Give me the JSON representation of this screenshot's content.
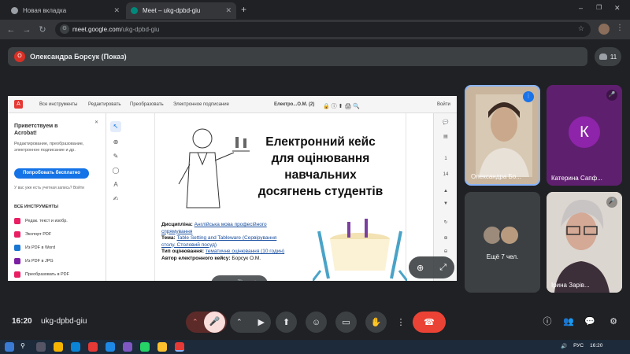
{
  "browser": {
    "tabs": [
      {
        "label": "Новая вкладка",
        "active": false
      },
      {
        "label": "Meet – ukg-dpbd-giu",
        "active": true
      }
    ],
    "url_host": "meet.google.com",
    "url_path": "/ukg-dpbd-giu"
  },
  "meet": {
    "presenter_initial": "О",
    "presenter_title": "Олександра Борсук (Показ)",
    "people_count": "11",
    "clock": "16:20",
    "meeting_code": "ukg-dpbd-giu"
  },
  "acrobat": {
    "tabs": [
      "Все инструменты",
      "Редактировать",
      "Преобразовать",
      "Электронное подписание"
    ],
    "doc_title": "Електро...О.М. (2)",
    "signin_btn": "Войти",
    "welcome": "Приветствуем в Acrobat!",
    "welcome_desc": "Редактирование, преобразование, электронное подписание и др.",
    "try_btn": "Попробовать бесплатно",
    "signin_prompt": "У вас уже есть учетная запись? Войти",
    "all_tools": "ВСЕ ИНСТРУМЕНТЫ",
    "tool_items": [
      "Редак. текст и изобр.",
      "Экспорт PDF",
      "Из PDF в Word",
      "Из PDF в JPG",
      "Преобразовать в PDF"
    ],
    "page_num": "1",
    "page_total": "14"
  },
  "slide": {
    "title_lines": [
      "Електронний кейс",
      "для оцінювання",
      "навчальних",
      "досягнень студентів"
    ],
    "info": [
      {
        "label": "Дисципліна:",
        "value": "Англійська мова професійного спрямування"
      },
      {
        "label": "Тема:",
        "value": "Table Setting and Tableware (Сервірування столу. Столовий посуд)"
      },
      {
        "label": "Тип оцінювання:",
        "value": "тематичне оцінювання (10 годин)"
      },
      {
        "label": "Автор електронного кейсу:",
        "value": "Борсук О.М."
      }
    ]
  },
  "participants": [
    {
      "name": "Олександра Бо...",
      "bg": "#c9b59d"
    },
    {
      "name": "Катерина Сапф...",
      "initial": "К",
      "bg": "#5f1f6f",
      "avatar_bg": "#8e24aa"
    },
    {
      "name": "Ещё 7 чел.",
      "bg": "#3c4043"
    },
    {
      "name": "Ірина Зарів...",
      "bg": "#d9d3cf"
    }
  ],
  "colors": {
    "end_call": "#ea4335",
    "mic_off": "#f9dedc",
    "accent": "#8ab4f8"
  }
}
